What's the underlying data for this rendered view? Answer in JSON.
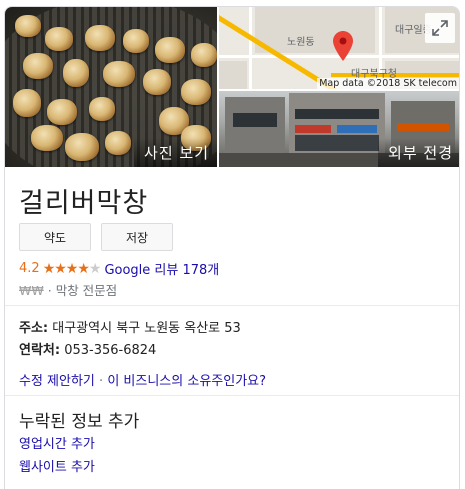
{
  "photos": {
    "main_label": "사진 보기",
    "street_label": "외부 전경"
  },
  "map": {
    "labels": {
      "road": "노원동",
      "top_right": "대구일중",
      "bottom_place": "대구북구청"
    },
    "attribution": "Map data ©2018 SK telecom",
    "expand_icon": "expand-icon",
    "pin_color": "#ea4335"
  },
  "place": {
    "name": "걸리버막창",
    "buttons": {
      "directions": "약도",
      "save": "저장"
    },
    "rating": {
      "value": "4.2",
      "stars_filled": 4,
      "stars_total": 5,
      "reviews_text": "Google 리뷰 178개"
    },
    "price": "₩₩",
    "separator": "·",
    "category": "막창 전문점",
    "address_label": "주소:",
    "address": "대구광역시 북구 노원동 옥산로 53",
    "phone_label": "연락처:",
    "phone": "053-356-6824"
  },
  "suggest": {
    "edit": "수정 제안하기",
    "separator": "·",
    "owner": "이 비즈니스의 소유주인가요?"
  },
  "missing": {
    "title": "누락된 정보 추가",
    "hours": "영업시간 추가",
    "website": "웹사이트 추가"
  },
  "colors": {
    "link": "#1a0dab",
    "star": "#e7711b",
    "road": "#f6b900"
  }
}
